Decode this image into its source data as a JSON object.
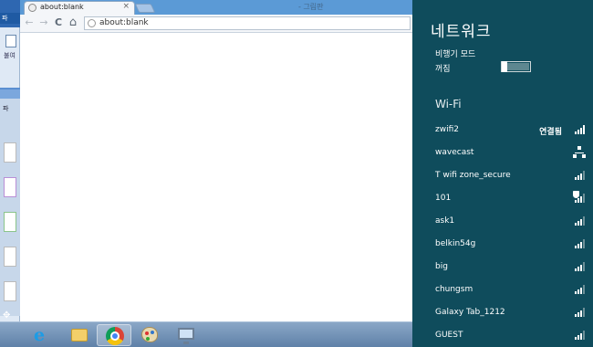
{
  "background": {
    "paint_menu": "파",
    "doc_label": "불여",
    "second_window_tab": "파"
  },
  "browser": {
    "tab_title": "about:blank",
    "tab_close": "×",
    "background_title": "- 그림판",
    "nav_back": "←",
    "nav_forward": "→",
    "nav_reload": "C",
    "nav_home": "⌂",
    "url": "about:blank"
  },
  "taskbar": {
    "apps": [
      "internet-explorer",
      "file-explorer",
      "chrome",
      "paint",
      "remote-desktop"
    ],
    "active_app": "chrome"
  },
  "network_panel": {
    "title": "네트워크",
    "airplane_mode_label": "비행기 모드",
    "airplane_mode_state": "꺼짐",
    "airplane_mode_on": false,
    "wifi_header": "Wi-Fi",
    "networks": [
      {
        "ssid": "zwifi2",
        "status": "연결됨",
        "signal": 4,
        "icon": "signal-icon"
      },
      {
        "ssid": "wavecast",
        "status": "",
        "signal": 0,
        "icon": "adhoc-network-icon"
      },
      {
        "ssid": "T wifi zone_secure",
        "status": "",
        "signal": 3,
        "icon": "signal-icon"
      },
      {
        "ssid": "101",
        "status": "",
        "signal": 3,
        "icon": "open-network-shield-icon"
      },
      {
        "ssid": "ask1",
        "status": "",
        "signal": 3,
        "icon": "signal-icon"
      },
      {
        "ssid": "belkin54g",
        "status": "",
        "signal": 3,
        "icon": "signal-icon"
      },
      {
        "ssid": "big",
        "status": "",
        "signal": 3,
        "icon": "signal-icon"
      },
      {
        "ssid": "chungsm",
        "status": "",
        "signal": 3,
        "icon": "signal-icon"
      },
      {
        "ssid": "Galaxy Tab_1212",
        "status": "",
        "signal": 3,
        "icon": "signal-icon"
      },
      {
        "ssid": "GUEST",
        "status": "",
        "signal": 3,
        "icon": "signal-icon"
      }
    ]
  },
  "colors": {
    "flyout_bg": "#0f4c5c",
    "taskbar": "#6e8fb4",
    "tabstrip": "#5b9ad6"
  }
}
